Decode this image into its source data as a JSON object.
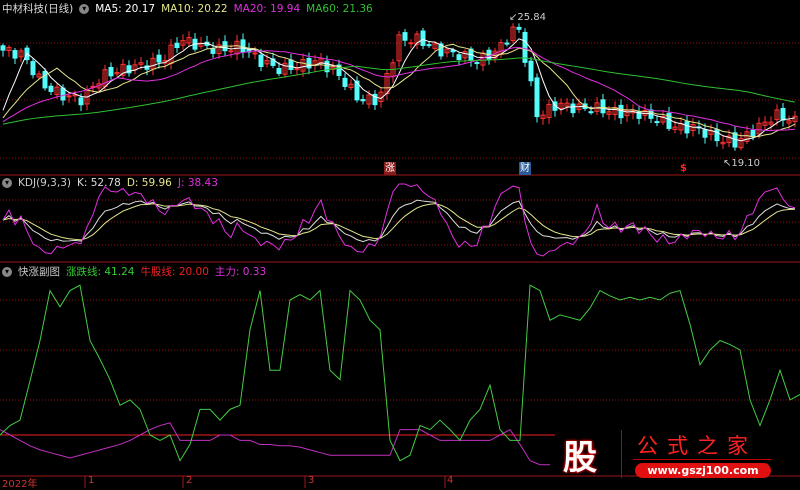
{
  "header": {
    "title": "中材科技(日线)",
    "ma5": "MA5: 20.17",
    "ma10": "MA10: 20.22",
    "ma20": "MA20: 19.94",
    "ma60": "MA60: 21.36"
  },
  "kdj_header": {
    "name": "KDJ(9,3,3)",
    "k": "K: 52.78",
    "d": "D: 59.96",
    "j": "J: 38.43"
  },
  "sub_header": {
    "name": "快涨副图",
    "line1": "涨跌线: 41.24",
    "line2": "牛股线: 20.00",
    "line3": "主力: 0.33"
  },
  "markers": {
    "max": "25.84",
    "min": "19.10",
    "tag1": "涨",
    "tag2": "财",
    "tag3": "$"
  },
  "xaxis": {
    "year": "2022年",
    "months": [
      "1",
      "2",
      "3",
      "4"
    ]
  },
  "logo": {
    "char": "股",
    "title": "公式之家",
    "url": "www.gszj100.com"
  },
  "colors": {
    "up": "#ff3232",
    "down": "#54fcfc",
    "ma5": "#ffffff",
    "ma10": "#e6e68c",
    "ma20": "#e030e0",
    "ma60": "#30c030",
    "grid": "#8b1010"
  },
  "chart_data": {
    "type": "candlestick",
    "price_range": [
      19.1,
      25.84
    ],
    "close_keypoints": [
      24.3,
      24.1,
      22.7,
      22.2,
      22.0,
      23.1,
      23.4,
      23.6,
      23.8,
      24.8,
      24.5,
      24.3,
      24.5,
      23.8,
      23.4,
      23.6,
      23.8,
      23.1,
      22.0,
      22.0,
      24.8,
      24.8,
      24.3,
      24.1,
      23.8,
      24.3,
      25.5,
      21.2,
      21.8,
      21.6,
      21.6,
      21.4,
      21.4,
      21.1,
      20.7,
      20.7,
      20.2,
      20.0,
      20.6,
      21.3,
      21.0
    ],
    "sub_indicator": {
      "ylim": [
        0,
        135
      ],
      "zhangdie": [
        20,
        27,
        31,
        60,
        90,
        127,
        115,
        127,
        131,
        90,
        76,
        61,
        42,
        46,
        39,
        20,
        16,
        20,
        1,
        13,
        39,
        39,
        31,
        39,
        42,
        98,
        127,
        68,
        68,
        120,
        124,
        120,
        127,
        68,
        61,
        127,
        120,
        105,
        98,
        16,
        1,
        5,
        27,
        24,
        31,
        24,
        16,
        31,
        39,
        57,
        24,
        16,
        16,
        131,
        127,
        105,
        109,
        107,
        105,
        114,
        127,
        123,
        120,
        122,
        120,
        122,
        120,
        125,
        127,
        102,
        72,
        83,
        90,
        87,
        83,
        46,
        27,
        46,
        68,
        46,
        50
      ],
      "niugu": 20,
      "zhuli": [
        24,
        20,
        16,
        12,
        9,
        7,
        5,
        3,
        5,
        7,
        9,
        11,
        13,
        16,
        20,
        24,
        27,
        29,
        16,
        16,
        16,
        16,
        20,
        20,
        16,
        16,
        13,
        13,
        12,
        12,
        11,
        9,
        7,
        5,
        5,
        5,
        5,
        5,
        5,
        5,
        24,
        24,
        24,
        20,
        16,
        16,
        16,
        16,
        16,
        16,
        20,
        24,
        13,
        1,
        -2,
        -2,
        -2,
        -1,
        1,
        1,
        1,
        1,
        1,
        1,
        1,
        1,
        1,
        1,
        1,
        1,
        1,
        1,
        1,
        1,
        1,
        1,
        1,
        1,
        1,
        1,
        1
      ]
    }
  }
}
